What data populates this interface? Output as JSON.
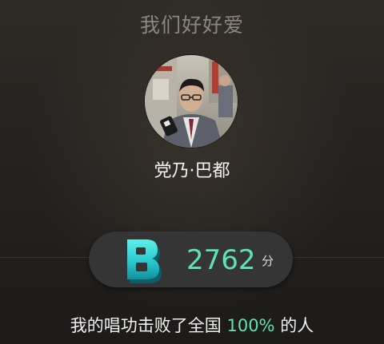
{
  "song": {
    "title": "我们好好爱"
  },
  "singer": {
    "name": "党乃·巴都",
    "avatar_icon": "singer-photo"
  },
  "score": {
    "grade": "B",
    "value": "2762",
    "unit": "分",
    "accent_color": "#5fe3b5"
  },
  "result": {
    "prefix": "我的唱功击败了全国 ",
    "percent": "100%",
    "suffix": " 的人"
  }
}
